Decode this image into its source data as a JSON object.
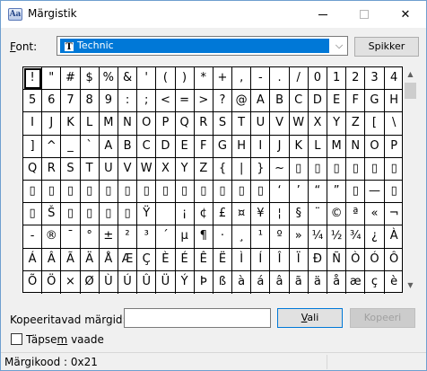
{
  "window": {
    "title": "Märgistik",
    "close_glyph": "✕"
  },
  "font_row": {
    "label_prefix": "",
    "label_mnemonic": "F",
    "label_rest": "ont:",
    "selected_font": "Technic",
    "tt_glyph": "T",
    "dropdown_arrow": "⌵",
    "help_button": "Spikker"
  },
  "character_grid": {
    "selected_index": 0,
    "rows": [
      [
        "!",
        "\"",
        "#",
        "$",
        "%",
        "&",
        "'",
        "(",
        ")",
        "*",
        "+",
        ",",
        "-",
        ".",
        "/",
        "0",
        "1",
        "2",
        "3",
        "4"
      ],
      [
        "5",
        "6",
        "7",
        "8",
        "9",
        ":",
        ";",
        "<",
        "=",
        ">",
        "?",
        "@",
        "A",
        "B",
        "C",
        "D",
        "E",
        "F",
        "G",
        "H"
      ],
      [
        "I",
        "J",
        "K",
        "L",
        "M",
        "N",
        "O",
        "P",
        "Q",
        "R",
        "S",
        "T",
        "U",
        "V",
        "W",
        "X",
        "Y",
        "Z",
        "[",
        "\\"
      ],
      [
        "]",
        "^",
        "_",
        "`",
        "A",
        "B",
        "C",
        "D",
        "E",
        "F",
        "G",
        "H",
        "I",
        "J",
        "K",
        "L",
        "M",
        "N",
        "O",
        "P"
      ],
      [
        "Q",
        "R",
        "S",
        "T",
        "U",
        "V",
        "W",
        "X",
        "Y",
        "Z",
        "{",
        "|",
        "}",
        "~",
        "▯",
        "▯",
        "▯",
        "▯",
        "▯",
        "▯"
      ],
      [
        "▯",
        "▯",
        "▯",
        "▯",
        "▯",
        "▯",
        "▯",
        "▯",
        "▯",
        "▯",
        "▯",
        "▯",
        "▯",
        "‘",
        "’",
        "“",
        "”",
        "▯",
        "—",
        "▯"
      ],
      [
        "▯",
        "Š",
        "▯",
        "▯",
        "▯",
        "▯",
        "Ÿ",
        "",
        "¡",
        "¢",
        "£",
        "¤",
        "¥",
        "¦",
        "§",
        "¨",
        "©",
        "ª",
        "«",
        "¬"
      ],
      [
        "-",
        "®",
        "¯",
        "°",
        "±",
        "²",
        "³",
        "´",
        "µ",
        "¶",
        "·",
        "¸",
        "¹",
        "º",
        "»",
        "¼",
        "½",
        "¾",
        "¿",
        "À"
      ],
      [
        "Á",
        "Â",
        "Ã",
        "Ä",
        "Å",
        "Æ",
        "Ç",
        "È",
        "É",
        "Ê",
        "Ë",
        "Ì",
        "Í",
        "Î",
        "Ï",
        "Ð",
        "Ñ",
        "Ò",
        "Ó",
        "Ô"
      ],
      [
        "Õ",
        "Ö",
        "×",
        "Ø",
        "Ù",
        "Ú",
        "Û",
        "Ü",
        "Ý",
        "Þ",
        "ß",
        "à",
        "á",
        "â",
        "ã",
        "ä",
        "å",
        "æ",
        "ç",
        "è"
      ]
    ]
  },
  "scrollbar": {
    "up_arrow": "▲",
    "down_arrow": "▼",
    "position": 0
  },
  "copy_row": {
    "label": "Kopeeritavad märgid:",
    "input_value": "",
    "select_button_mnemonic": "V",
    "select_button_rest": "ali",
    "copy_button": "Kopeeri"
  },
  "advanced_view": {
    "label_prefix": "Täpse",
    "label_mnemonic": "m",
    "label_rest": " vaade",
    "checked": false
  },
  "status": {
    "text": "Märgikood : 0x21"
  }
}
